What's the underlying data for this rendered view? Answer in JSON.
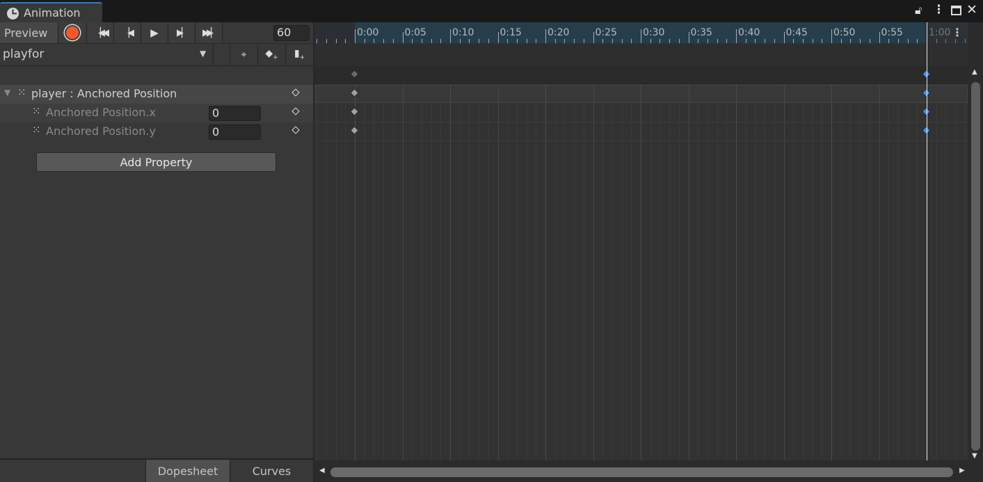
{
  "window": {
    "tab_title": "Animation",
    "tab_icon": "clock-icon"
  },
  "toolbar": {
    "preview_label": "Preview",
    "frame_value": "60",
    "record_color": "#f05a2c"
  },
  "clip": {
    "name": "playfor"
  },
  "properties": [
    {
      "label": "player : Anchored Position",
      "value": null
    },
    {
      "label": "Anchored Position.x",
      "value": "0"
    },
    {
      "label": "Anchored Position.y",
      "value": "0"
    }
  ],
  "add_property_label": "Add Property",
  "bottom_tabs": {
    "dopesheet": "Dopesheet",
    "curves": "Curves"
  },
  "timeline": {
    "ruler_labels": [
      "0:00",
      "0:05",
      "0:10",
      "0:15",
      "0:20",
      "0:25",
      "0:30",
      "0:35",
      "0:40",
      "0:45",
      "0:50",
      "0:55",
      "1:00"
    ],
    "current_frame": 60,
    "keyframes": [
      0,
      60
    ],
    "selected_key_color": "#4a8ee8"
  }
}
